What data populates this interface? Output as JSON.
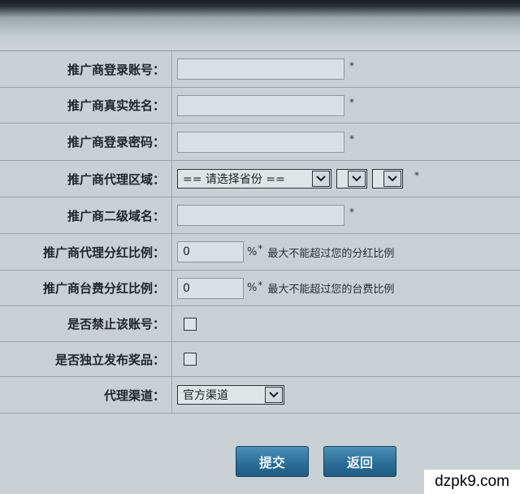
{
  "form": {
    "rows": [
      {
        "label": "推广商登录账号：",
        "value": "",
        "required_mark": "*"
      },
      {
        "label": "推广商真实姓名：",
        "value": "",
        "required_mark": "*"
      },
      {
        "label": "推广商登录密码：",
        "value": "",
        "required_mark": "*"
      },
      {
        "label": "推广商代理区域：",
        "province_select": "== 请选择省份 ==",
        "city_select": "",
        "district_select": "",
        "required_mark": "*"
      },
      {
        "label": "推广商二级域名：",
        "value": "",
        "required_mark": "*"
      },
      {
        "label": "推广商代理分红比例：",
        "value": "0",
        "suffix": "%",
        "required_mark": "*",
        "hint": "最大不能超过您的分红比例"
      },
      {
        "label": "推广商台费分红比例：",
        "value": "0",
        "suffix": "%",
        "required_mark": "*",
        "hint": "最大不能超过您的台费比例"
      },
      {
        "label": "是否禁止该账号：",
        "checked": false
      },
      {
        "label": "是否独立发布奖品：",
        "checked": false
      },
      {
        "label": "代理渠道：",
        "select_value": "官方渠道"
      }
    ]
  },
  "buttons": {
    "submit": "提交",
    "back": "返回"
  },
  "watermark": "dzpk9.com",
  "icons": {
    "dropdown": "chevron-down-icon"
  }
}
